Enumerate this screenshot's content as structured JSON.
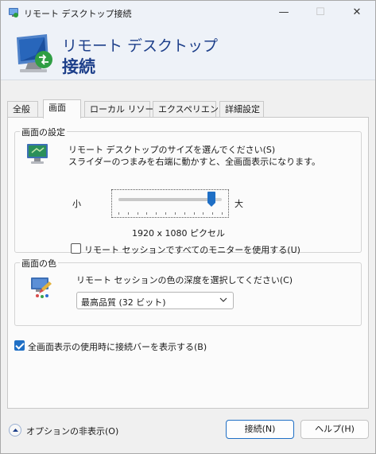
{
  "window": {
    "title": "リモート デスクトップ接続"
  },
  "banner": {
    "line1": "リモート デスクトップ",
    "line2": "接続"
  },
  "tabs": [
    {
      "label": "全般",
      "active": false
    },
    {
      "label": "画面",
      "active": true
    },
    {
      "label": "ローカル リソース",
      "active": false
    },
    {
      "label": "エクスペリエンス",
      "active": false
    },
    {
      "label": "詳細設定",
      "active": false
    }
  ],
  "display_settings": {
    "group_title": "画面の設定",
    "description_line1": "リモート デスクトップのサイズを選んでください(S)",
    "description_line2": "スライダーのつまみを右端に動かすと、全画面表示になります。",
    "slider": {
      "min_label": "小",
      "max_label": "大",
      "value_fraction": 0.9,
      "resolution": "1920 x 1080 ピクセル"
    },
    "all_monitors": {
      "label": "リモート セッションですべてのモニターを使用する(U)",
      "checked": false
    }
  },
  "colors": {
    "group_title": "画面の色",
    "description": "リモート セッションの色の深度を選択してください(C)",
    "selected_option": "最高品質 (32 ビット)"
  },
  "connection_bar": {
    "label": "全画面表示の使用時に接続バーを表示する(B)",
    "checked": true
  },
  "footer": {
    "options_label": "オプションの非表示(O)",
    "connect_label": "接続(N)",
    "help_label": "ヘルプ(H)"
  },
  "theme": {
    "accent": "#1f6fc5",
    "banner_text": "#1d3f8a"
  }
}
